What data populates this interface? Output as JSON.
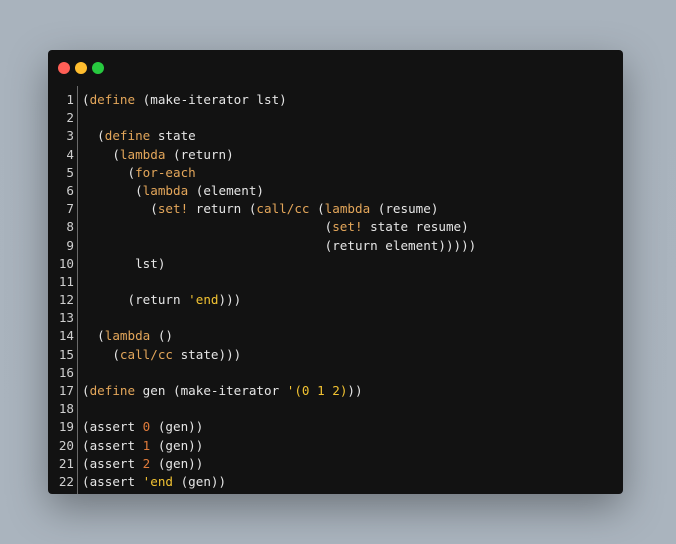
{
  "window": {
    "title": "",
    "controls": [
      "close",
      "minimize",
      "maximize"
    ]
  },
  "colors": {
    "keyword": "#e3a65a",
    "string": "#f1c232",
    "number": "#e07b3b",
    "text": "#e6e6e6",
    "background": "#121212"
  },
  "code": [
    {
      "n": "1",
      "tokens": [
        {
          "t": "(",
          "c": ""
        },
        {
          "t": "define",
          "c": "kw"
        },
        {
          "t": " (make-iterator lst)",
          "c": ""
        }
      ]
    },
    {
      "n": "2",
      "tokens": []
    },
    {
      "n": "3",
      "tokens": [
        {
          "t": "  (",
          "c": ""
        },
        {
          "t": "define",
          "c": "kw"
        },
        {
          "t": " state",
          "c": ""
        }
      ]
    },
    {
      "n": "4",
      "tokens": [
        {
          "t": "    (",
          "c": ""
        },
        {
          "t": "lambda",
          "c": "kw"
        },
        {
          "t": " (return)",
          "c": ""
        }
      ]
    },
    {
      "n": "5",
      "tokens": [
        {
          "t": "      (",
          "c": ""
        },
        {
          "t": "for-each",
          "c": "kw"
        }
      ]
    },
    {
      "n": "6",
      "tokens": [
        {
          "t": "       (",
          "c": ""
        },
        {
          "t": "lambda",
          "c": "kw"
        },
        {
          "t": " (element)",
          "c": ""
        }
      ]
    },
    {
      "n": "7",
      "tokens": [
        {
          "t": "         (",
          "c": ""
        },
        {
          "t": "set!",
          "c": "kw"
        },
        {
          "t": " return (",
          "c": ""
        },
        {
          "t": "call/cc",
          "c": "kw"
        },
        {
          "t": " (",
          "c": ""
        },
        {
          "t": "lambda",
          "c": "kw"
        },
        {
          "t": " (resume)",
          "c": ""
        }
      ]
    },
    {
      "n": "8",
      "tokens": [
        {
          "t": "                                (",
          "c": ""
        },
        {
          "t": "set!",
          "c": "kw"
        },
        {
          "t": " state resume)",
          "c": ""
        }
      ]
    },
    {
      "n": "9",
      "tokens": [
        {
          "t": "                                (return element)))))",
          "c": ""
        }
      ]
    },
    {
      "n": "10",
      "tokens": [
        {
          "t": "       lst)",
          "c": ""
        }
      ]
    },
    {
      "n": "11",
      "tokens": []
    },
    {
      "n": "12",
      "tokens": [
        {
          "t": "      (return ",
          "c": ""
        },
        {
          "t": "'end",
          "c": "str"
        },
        {
          "t": ")))",
          "c": ""
        }
      ]
    },
    {
      "n": "13",
      "tokens": []
    },
    {
      "n": "14",
      "tokens": [
        {
          "t": "  (",
          "c": ""
        },
        {
          "t": "lambda",
          "c": "kw"
        },
        {
          "t": " ()",
          "c": ""
        }
      ]
    },
    {
      "n": "15",
      "tokens": [
        {
          "t": "    (",
          "c": ""
        },
        {
          "t": "call/cc",
          "c": "kw"
        },
        {
          "t": " state)))",
          "c": ""
        }
      ]
    },
    {
      "n": "16",
      "tokens": []
    },
    {
      "n": "17",
      "tokens": [
        {
          "t": "(",
          "c": ""
        },
        {
          "t": "define",
          "c": "kw"
        },
        {
          "t": " gen (make-iterator ",
          "c": ""
        },
        {
          "t": "'(0 1 2)",
          "c": "str"
        },
        {
          "t": "))",
          "c": ""
        }
      ]
    },
    {
      "n": "18",
      "tokens": []
    },
    {
      "n": "19",
      "tokens": [
        {
          "t": "(assert ",
          "c": ""
        },
        {
          "t": "0",
          "c": "num"
        },
        {
          "t": " (gen))",
          "c": ""
        }
      ]
    },
    {
      "n": "20",
      "tokens": [
        {
          "t": "(assert ",
          "c": ""
        },
        {
          "t": "1",
          "c": "num"
        },
        {
          "t": " (gen))",
          "c": ""
        }
      ]
    },
    {
      "n": "21",
      "tokens": [
        {
          "t": "(assert ",
          "c": ""
        },
        {
          "t": "2",
          "c": "num"
        },
        {
          "t": " (gen))",
          "c": ""
        }
      ]
    },
    {
      "n": "22",
      "tokens": [
        {
          "t": "(assert ",
          "c": ""
        },
        {
          "t": "'end",
          "c": "str"
        },
        {
          "t": " (gen))",
          "c": ""
        }
      ]
    }
  ]
}
